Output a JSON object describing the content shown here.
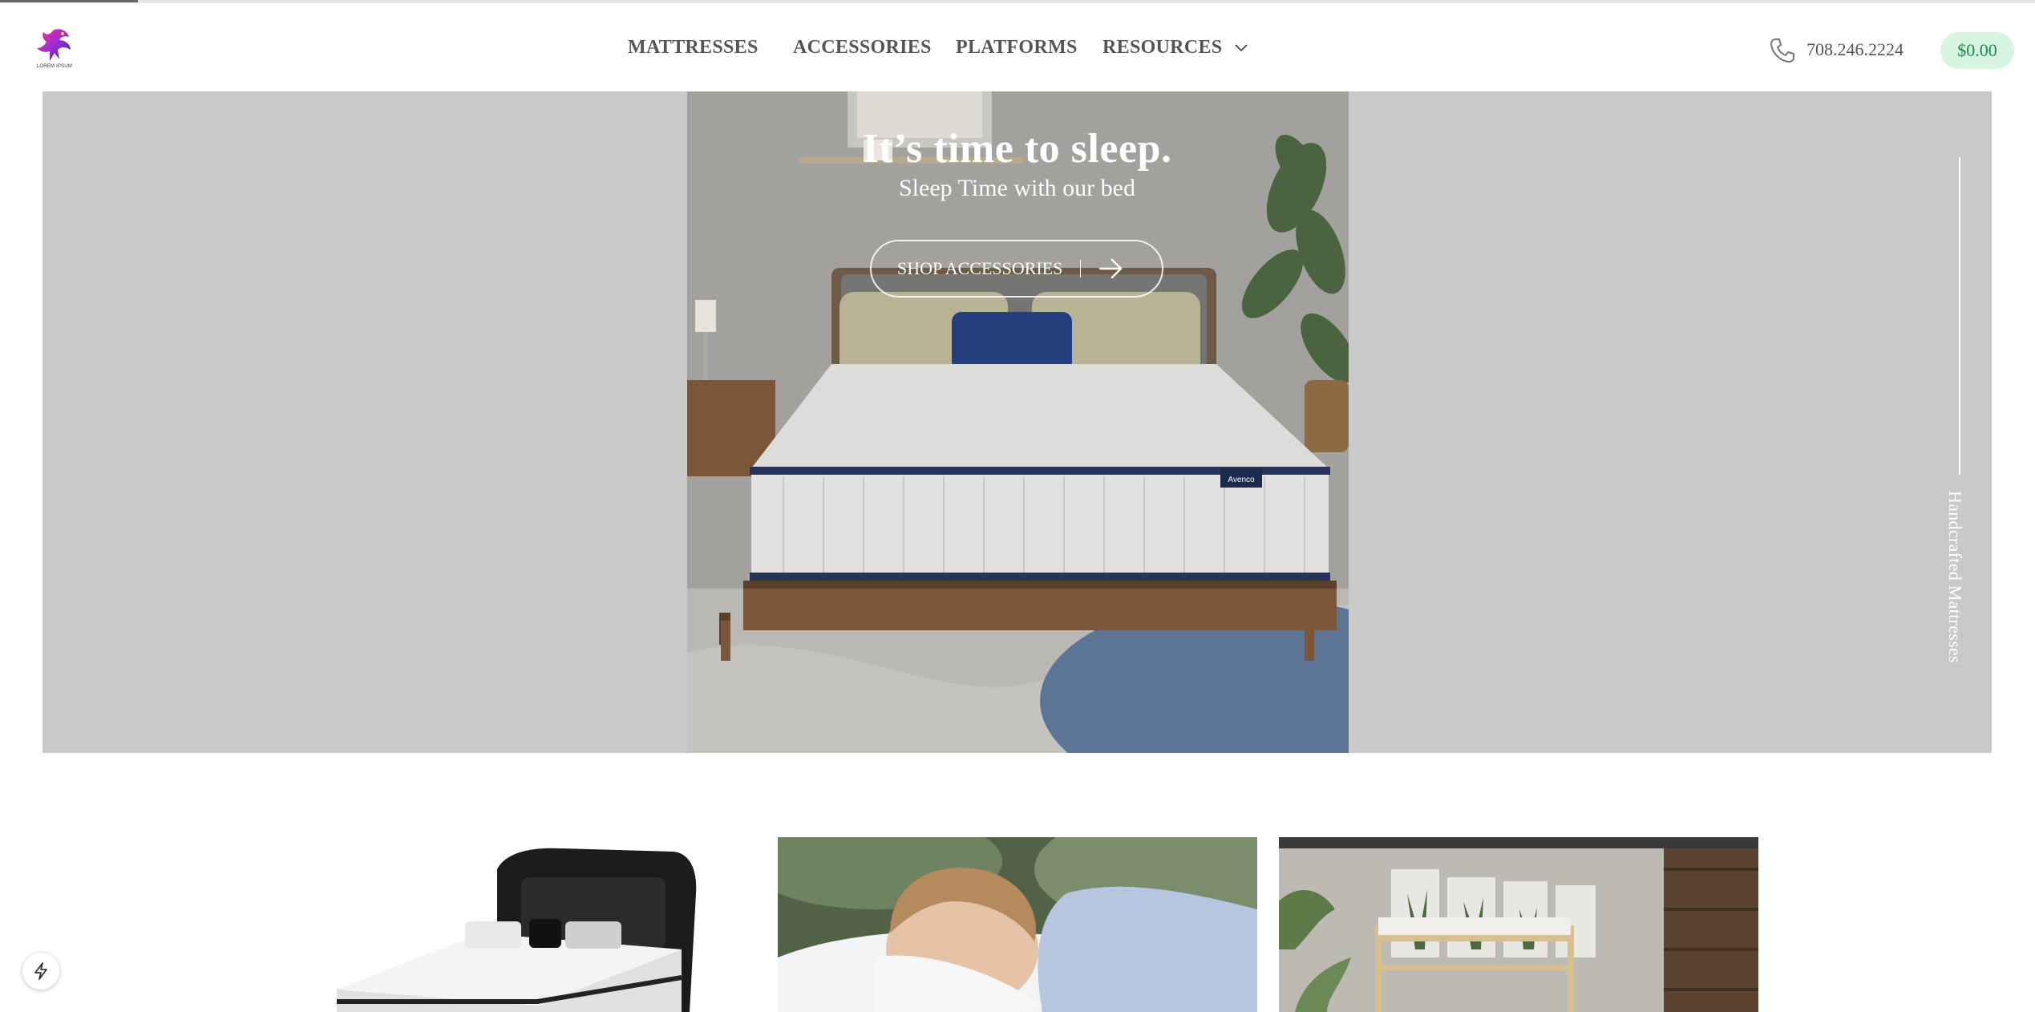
{
  "header": {
    "logo_text": "LOREM IPSUM",
    "nav": [
      {
        "label": "MATTRESSES"
      },
      {
        "label": "ACCESSORIES"
      },
      {
        "label": "PLATFORMS"
      },
      {
        "label": "RESOURCES"
      }
    ],
    "phone": "708.246.2224",
    "cart_total": "$0.00"
  },
  "hero": {
    "title": "It’s time to sleep.",
    "subtitle": "Sleep Time with our bed",
    "cta_label": "SHOP ACCESSORIES",
    "side_text": "Handcrafted Mattresses",
    "mattress_brand": "Avenco",
    "background_color": "#c9c9c9"
  },
  "colors": {
    "accent_bg": "#d6f5e1",
    "accent_text": "#1b8a4a",
    "nav_text": "#555555"
  },
  "icons": {
    "phone": "phone-icon",
    "chevron": "chevron-down-icon",
    "arrow": "arrow-right-icon",
    "bolt": "bolt-icon"
  }
}
